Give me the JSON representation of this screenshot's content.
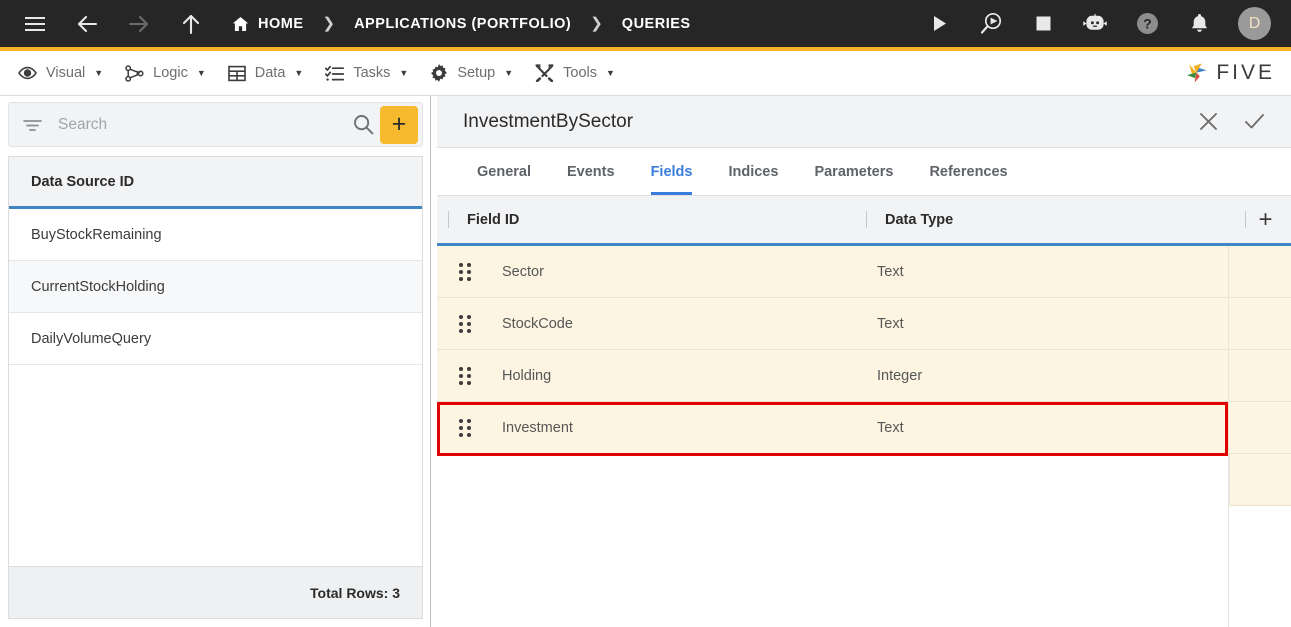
{
  "topbar": {
    "menu_icon": "hamburger-icon",
    "back_icon": "arrow-left-icon",
    "forward_icon": "arrow-right-icon",
    "up_icon": "arrow-up-icon",
    "breadcrumbs": [
      {
        "label": "HOME",
        "icon": "home-icon"
      },
      {
        "label": "APPLICATIONS (PORTFOLIO)",
        "icon": ""
      },
      {
        "label": "QUERIES",
        "icon": ""
      }
    ],
    "separator": "❯",
    "actions": [
      {
        "name": "run-icon",
        "title": "Run"
      },
      {
        "name": "debug-icon",
        "title": "Debug"
      },
      {
        "name": "stop-icon",
        "title": "Stop"
      },
      {
        "name": "chatbot-icon",
        "title": "Assistant"
      },
      {
        "name": "help-icon",
        "title": "Help"
      },
      {
        "name": "notifications-icon",
        "title": "Notifications"
      }
    ],
    "avatar_initial": "D"
  },
  "menubar": {
    "items": [
      {
        "label": "Visual",
        "icon": "eye-icon",
        "caret": "▼"
      },
      {
        "label": "Logic",
        "icon": "nodes-icon",
        "caret": "▼"
      },
      {
        "label": "Data",
        "icon": "table-icon",
        "caret": "▼"
      },
      {
        "label": "Tasks",
        "icon": "checklist-icon",
        "caret": "▼"
      },
      {
        "label": "Setup",
        "icon": "gear-icon",
        "caret": "▼"
      },
      {
        "label": "Tools",
        "icon": "tools-icon",
        "caret": "▼"
      }
    ],
    "brand": "FIVE"
  },
  "sidebar": {
    "search": {
      "value": "",
      "placeholder": "Search",
      "filter_icon": "filter-icon",
      "search_icon": "search-icon"
    },
    "add_button": {
      "label": "+",
      "name": "add-record-button"
    },
    "list_header": "Data Source ID",
    "items": [
      {
        "label": "BuyStockRemaining"
      },
      {
        "label": "CurrentStockHolding"
      },
      {
        "label": "DailyVolumeQuery"
      }
    ],
    "footer": "Total Rows: 3"
  },
  "main": {
    "title": "InvestmentBySector",
    "close_icon": "close-icon",
    "confirm_icon": "check-icon",
    "tabs": [
      {
        "label": "General",
        "active": false
      },
      {
        "label": "Events",
        "active": false
      },
      {
        "label": "Fields",
        "active": true
      },
      {
        "label": "Indices",
        "active": false
      },
      {
        "label": "Parameters",
        "active": false
      },
      {
        "label": "References",
        "active": false
      }
    ],
    "grid": {
      "columns": [
        "Field ID",
        "Data Type"
      ],
      "add_column_label": "+",
      "rows": [
        {
          "field_id": "Sector",
          "data_type": "Text",
          "highlighted": false
        },
        {
          "field_id": "StockCode",
          "data_type": "Text",
          "highlighted": false
        },
        {
          "field_id": "Holding",
          "data_type": "Integer",
          "highlighted": false
        },
        {
          "field_id": "Investment",
          "data_type": "Text",
          "highlighted": true
        }
      ]
    }
  },
  "colors": {
    "accent_yellow": "#f5b325",
    "accent_blue": "#4285c5",
    "tab_active": "#3b7ddd",
    "row_highlight_bg": "#fdf4e1",
    "annotation_red": "#e00000",
    "topbar_bg": "#262626"
  }
}
